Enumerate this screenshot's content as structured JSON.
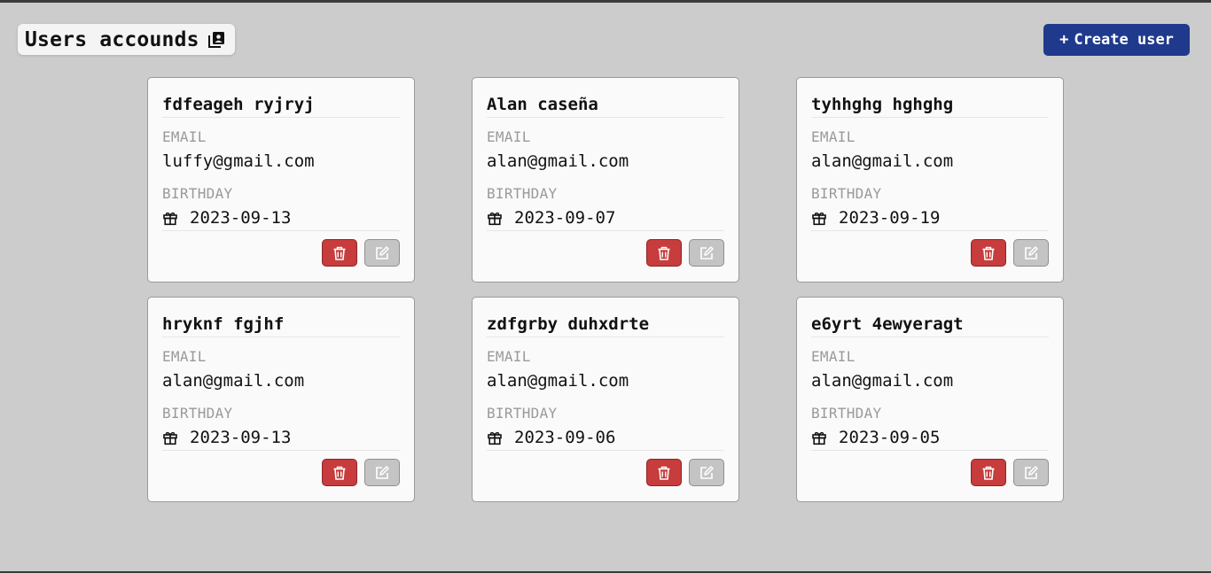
{
  "header": {
    "title": "Users accounds",
    "create_label": "Create user",
    "create_prefix": "+"
  },
  "labels": {
    "email": "EMAIL",
    "birthday": "BIRTHDAY"
  },
  "colors": {
    "background": "#cccccc",
    "primary": "#1f3a8c",
    "danger": "#c73c3c",
    "edit": "#c4c4c4"
  },
  "icons": {
    "title": "contact-book-icon",
    "birthday": "gift-icon",
    "delete": "trash-icon",
    "edit": "edit-icon"
  },
  "users": [
    {
      "name": "fdfeageh ryjryj",
      "email": "luffy@gmail.com",
      "birthday": "2023-09-13"
    },
    {
      "name": "Alan caseña",
      "email": "alan@gmail.com",
      "birthday": "2023-09-07"
    },
    {
      "name": "tyhhghg hghghg",
      "email": "alan@gmail.com",
      "birthday": "2023-09-19"
    },
    {
      "name": "hryknf fgjhf",
      "email": "alan@gmail.com",
      "birthday": "2023-09-13"
    },
    {
      "name": "zdfgrby duhxdrte",
      "email": "alan@gmail.com",
      "birthday": "2023-09-06"
    },
    {
      "name": "e6yrt 4ewyeragt",
      "email": "alan@gmail.com",
      "birthday": "2023-09-05"
    }
  ]
}
